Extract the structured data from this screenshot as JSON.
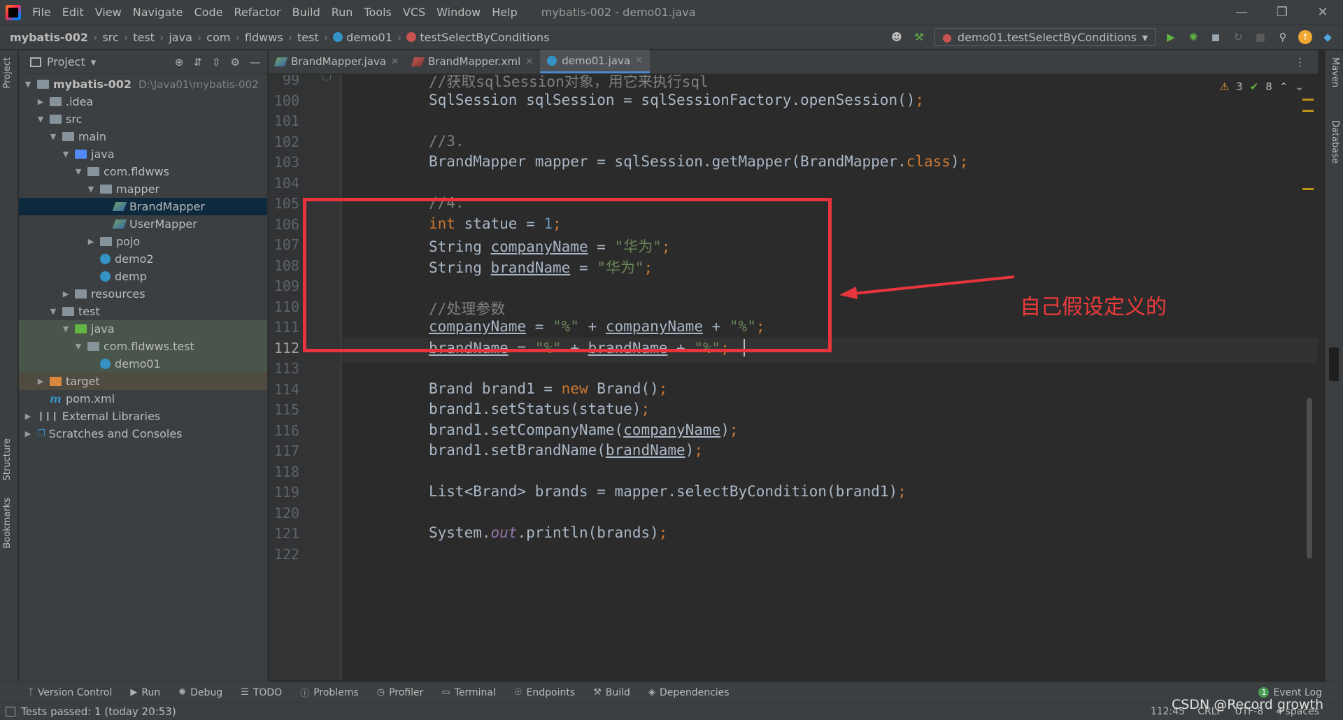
{
  "menubar": {
    "items": [
      "File",
      "Edit",
      "View",
      "Navigate",
      "Code",
      "Refactor",
      "Build",
      "Run",
      "Tools",
      "VCS",
      "Window",
      "Help"
    ],
    "window_title": "mybatis-002 - demo01.java"
  },
  "navbar": {
    "breadcrumbs": [
      "mybatis-002",
      "src",
      "test",
      "java",
      "com",
      "fldwws",
      "test",
      "demo01",
      "testSelectByConditions"
    ],
    "run_config": "demo01.testSelectByConditions"
  },
  "left_strip": {
    "project": "Project",
    "structure": "Structure",
    "bookmarks": "Bookmarks"
  },
  "right_strip": {
    "maven": "Maven",
    "database": "Database"
  },
  "project_panel": {
    "title": "Project",
    "tree": [
      {
        "label": "mybatis-002",
        "path": "D:\\Java01\\mybatis-002"
      },
      {
        "label": ".idea"
      },
      {
        "label": "src"
      },
      {
        "label": "main"
      },
      {
        "label": "java"
      },
      {
        "label": "com.fldwws"
      },
      {
        "label": "mapper"
      },
      {
        "label": "BrandMapper"
      },
      {
        "label": "UserMapper"
      },
      {
        "label": "pojo"
      },
      {
        "label": "demo2"
      },
      {
        "label": "demp"
      },
      {
        "label": "resources"
      },
      {
        "label": "test"
      },
      {
        "label": "java"
      },
      {
        "label": "com.fldwws.test"
      },
      {
        "label": "demo01"
      },
      {
        "label": "target"
      },
      {
        "label": "pom.xml"
      },
      {
        "label": "External Libraries"
      },
      {
        "label": "Scratches and Consoles"
      }
    ]
  },
  "tabs": [
    "BrandMapper.java",
    "BrandMapper.xml",
    "demo01.java"
  ],
  "editor": {
    "line_numbers": [
      "99",
      "100",
      "101",
      "102",
      "103",
      "104",
      "105",
      "106",
      "107",
      "108",
      "109",
      "110",
      "111",
      "112",
      "113",
      "114",
      "115",
      "116",
      "117",
      "118",
      "119",
      "120",
      "121",
      "122"
    ],
    "current_line": "112",
    "inspections": {
      "warnings": "3",
      "ok": "8"
    }
  },
  "annotation": {
    "text": "自己假设定义的"
  },
  "toolwindows": [
    "Version Control",
    "Run",
    "Debug",
    "TODO",
    "Problems",
    "Profiler",
    "Terminal",
    "Endpoints",
    "Build",
    "Dependencies"
  ],
  "event_log": {
    "count": "1",
    "label": "Event Log"
  },
  "statusbar": {
    "message": "Tests passed: 1 (today 20:53)",
    "position": "112:45",
    "line_sep": "CRLF",
    "encoding": "UTF-8",
    "indent": "4 spaces"
  },
  "watermark": "CSDN @Record growth",
  "colors": {
    "accent": "#4a88c7",
    "annotation": "#e8353d",
    "selection": "#0d293e"
  }
}
